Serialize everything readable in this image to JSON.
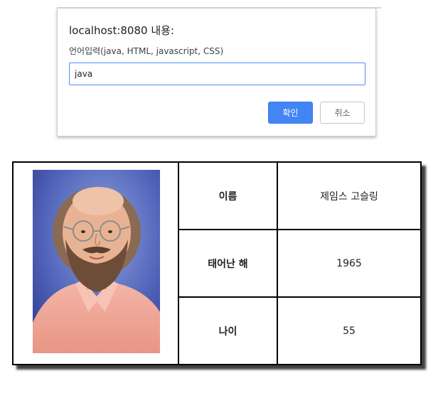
{
  "dialog": {
    "title": "localhost:8080 내용:",
    "message": "언어입력(java, HTML, javascript, CSS)",
    "input_value": "java",
    "ok_label": "확인",
    "cancel_label": "취소",
    "accent_color": "#4285f4"
  },
  "profile": {
    "photo_icon": "portrait-photo",
    "rows": [
      {
        "header": "이름",
        "value": "제임스 고슬링"
      },
      {
        "header": "태어난 해",
        "value": "1965"
      },
      {
        "header": "나이",
        "value": "55"
      }
    ]
  }
}
